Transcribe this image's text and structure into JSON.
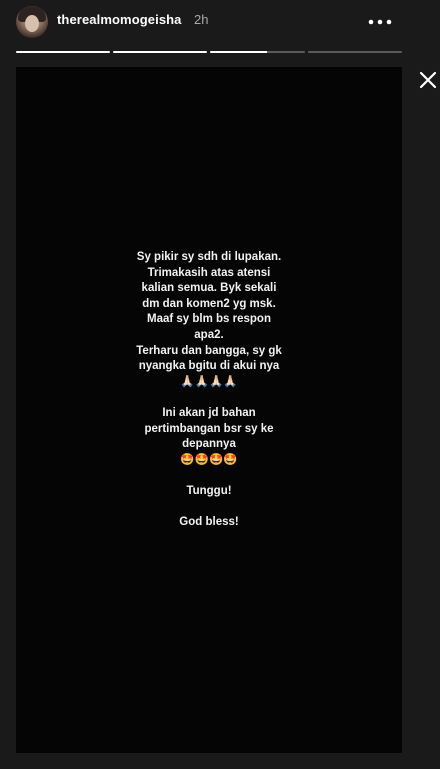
{
  "header": {
    "username": "therealmomogeisha",
    "time": "2h"
  },
  "icons": {
    "more": "more-options-icon",
    "close": "close-icon"
  },
  "progress": {
    "segments": [
      1,
      1,
      0.6,
      0
    ]
  },
  "story": {
    "lines": [
      "Sy pikir sy sdh di lupakan.",
      "Trimakasih atas atensi",
      "kalian semua. Byk sekali",
      "dm dan komen2 yg msk.",
      "Maaf sy blm bs respon",
      "apa2.",
      "Terharu dan bangga, sy gk",
      "nyangka bgitu di akui nya",
      "🙏🏻🙏🏻🙏🏻🙏🏻",
      "",
      "Ini akan jd bahan",
      "pertimbangan bsr sy ke",
      "depannya",
      "🤩🤩🤩🤩",
      "",
      "Tunggu!",
      "",
      "God bless!"
    ]
  }
}
